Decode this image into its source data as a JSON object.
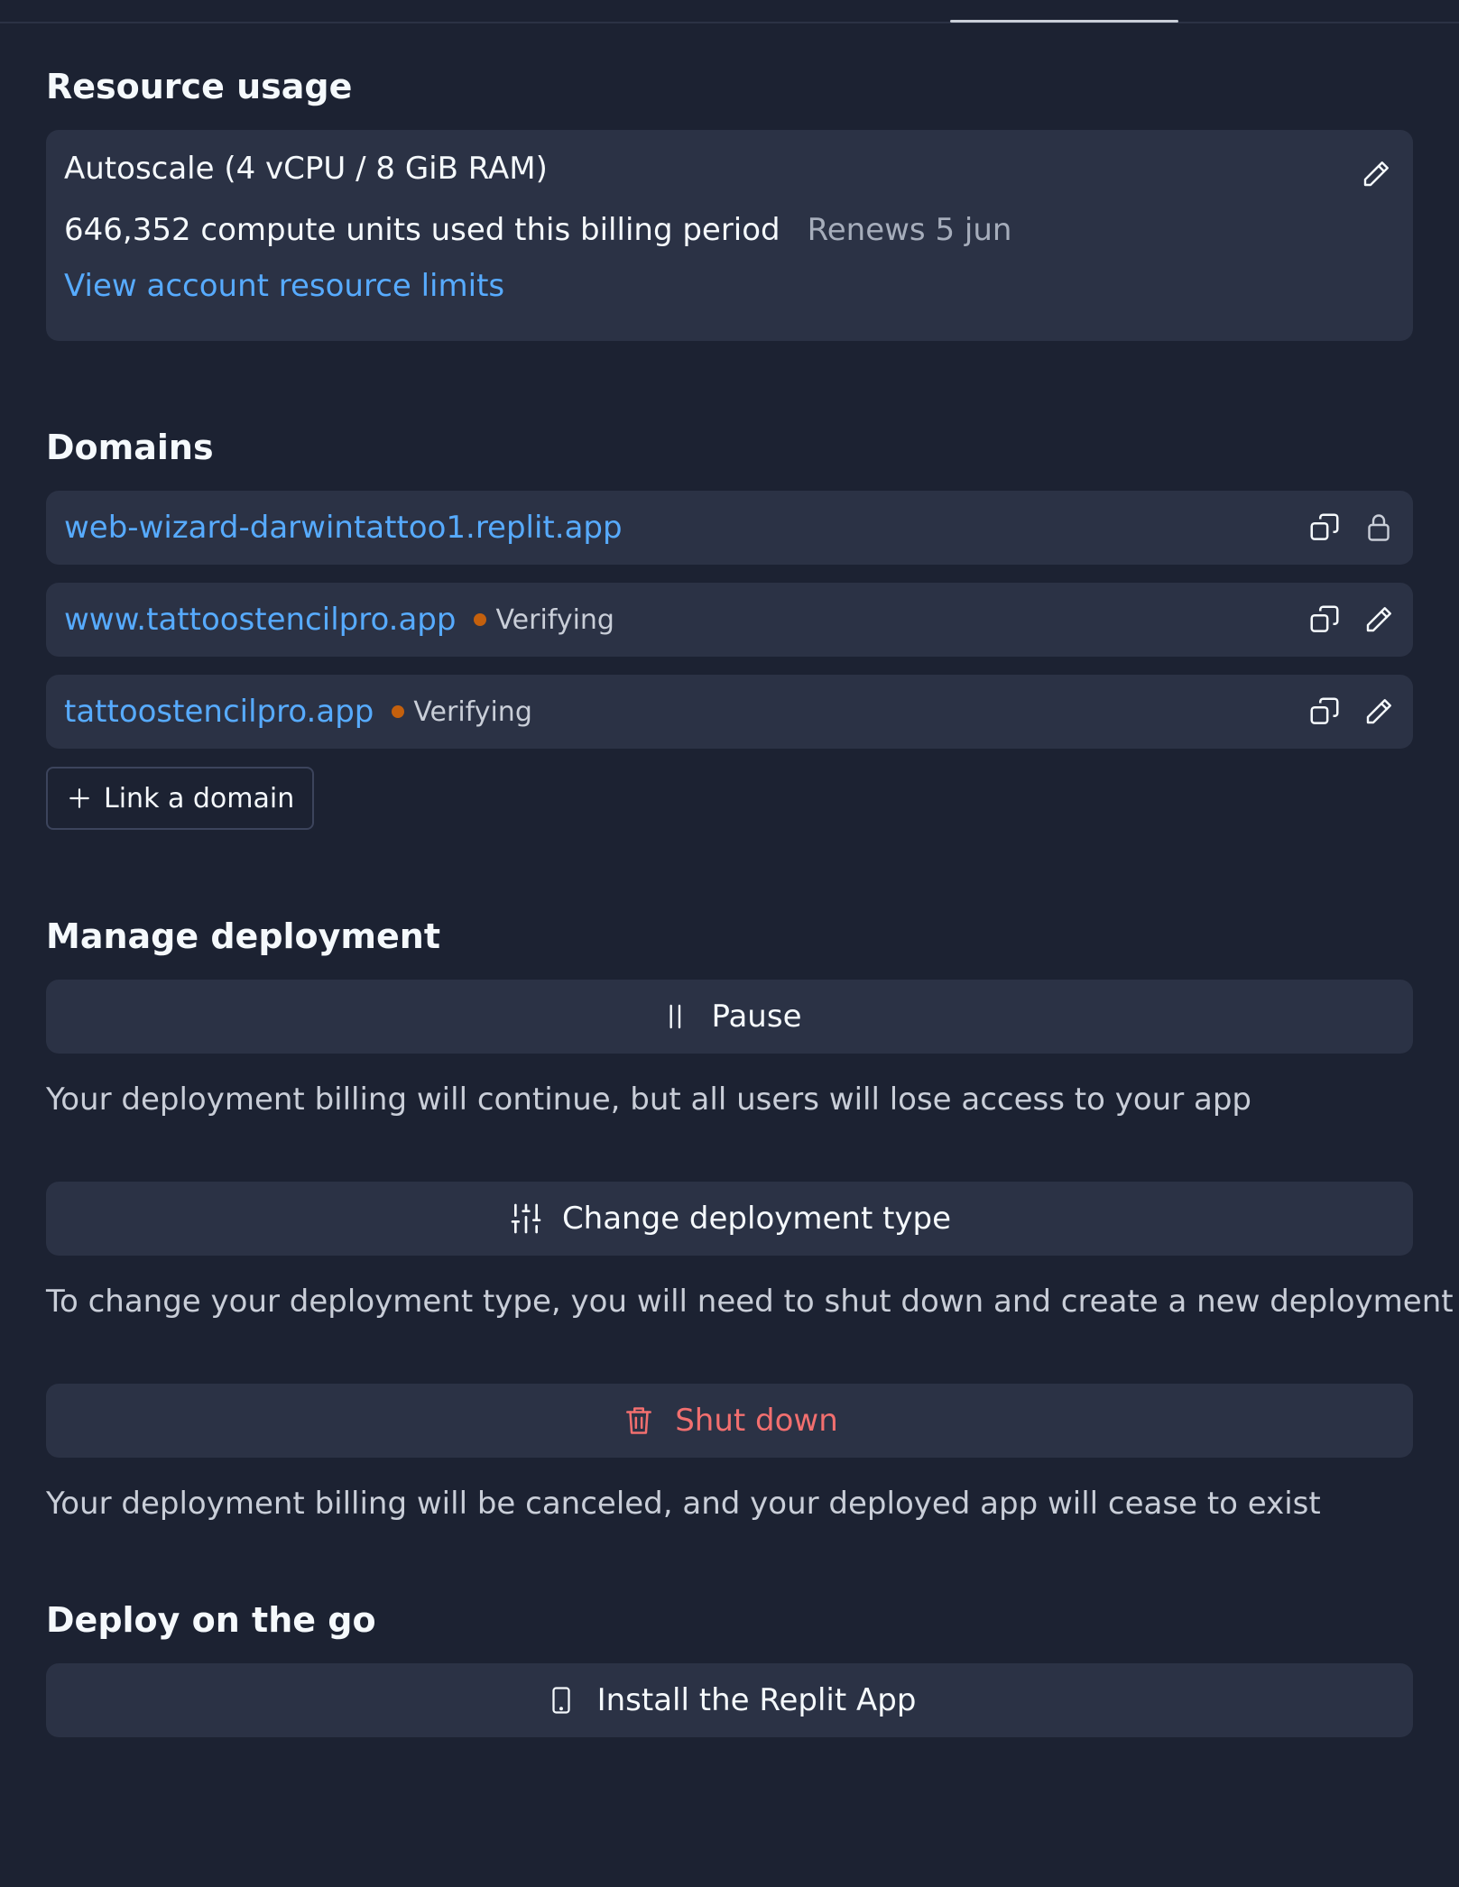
{
  "colors": {
    "background": "#1c2232",
    "card": "#2b3245",
    "link": "#57abff",
    "danger": "#f26f6f",
    "status_dot": "#c4600d",
    "muted_text": "#c9ced8"
  },
  "resource_usage": {
    "title": "Resource usage",
    "machine": "Autoscale (4 vCPU / 8 GiB RAM)",
    "compute_units": "646,352 compute units used this billing period",
    "renews": "Renews 5 jun",
    "limits_link": "View account resource limits",
    "edit_icon": "pencil-icon"
  },
  "domains": {
    "title": "Domains",
    "items": [
      {
        "url": "web-wizard-darwintattoo1.replit.app",
        "status": "",
        "icons": [
          "copy-icon",
          "lock-icon"
        ]
      },
      {
        "url": "www.tattoostencilpro.app",
        "status": "Verifying",
        "icons": [
          "copy-icon",
          "pencil-icon"
        ]
      },
      {
        "url": "tattoostencilpro.app",
        "status": "Verifying",
        "icons": [
          "copy-icon",
          "pencil-icon"
        ]
      }
    ],
    "link_button": "Link a domain"
  },
  "manage": {
    "title": "Manage deployment",
    "pause": {
      "label": "Pause",
      "icon": "pause-icon",
      "description": "Your deployment billing will continue, but all users will lose access to your app"
    },
    "change_type": {
      "label": "Change deployment type",
      "icon": "sliders-icon",
      "description": "To change your deployment type, you will need to shut down and create a new deployment"
    },
    "shutdown": {
      "label": "Shut down",
      "icon": "trash-icon",
      "description": "Your deployment billing will be canceled, and your deployed app will cease to exist"
    }
  },
  "mobile": {
    "title": "Deploy on the go",
    "install_button": "Install the Replit App",
    "icon": "phone-icon"
  }
}
